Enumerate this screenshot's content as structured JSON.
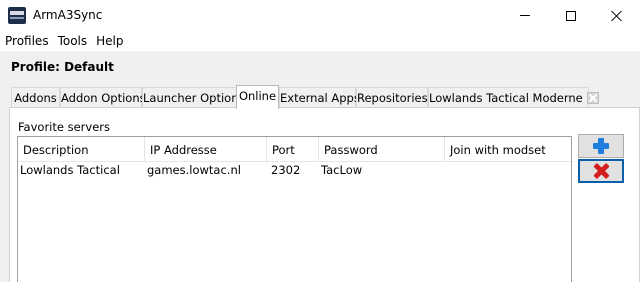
{
  "window": {
    "title": "ArmA3Sync"
  },
  "menu": {
    "items": [
      "Profiles",
      "Tools",
      "Help"
    ]
  },
  "profile": {
    "label": "Profile: Default"
  },
  "tabs": [
    {
      "label": "Addons"
    },
    {
      "label": "Addon Options"
    },
    {
      "label": "Launcher Options"
    },
    {
      "label": "Online",
      "active": true
    },
    {
      "label": "External Apps"
    },
    {
      "label": "Repositories"
    },
    {
      "label": "Lowlands Tactical Moderne"
    }
  ],
  "favorites": {
    "group_title": "Favorite servers",
    "columns": [
      "Description",
      "IP Addresse",
      "Port",
      "Password",
      "Join with modset"
    ],
    "rows": [
      [
        "Lowlands Tactical",
        "games.lowtac.nl",
        "2302",
        "TacLow",
        ""
      ]
    ]
  },
  "icons": {
    "add": "plus-icon",
    "remove": "remove-icon",
    "tab_close": "close-icon"
  },
  "colors": {
    "add_icon": "#1e7ee0",
    "remove_icon": "#d51f1f",
    "focus_border": "#0a5fa8"
  }
}
